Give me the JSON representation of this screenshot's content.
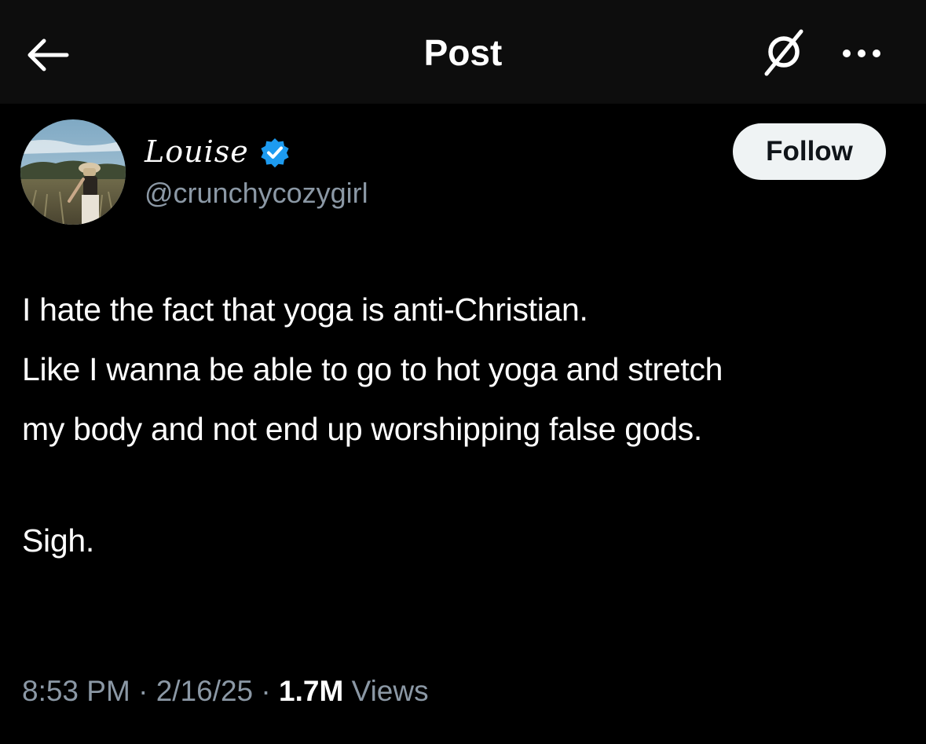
{
  "header": {
    "title": "Post",
    "back_icon": "arrow-left-icon",
    "grok_icon": "grok-icon",
    "more_icon": "more-horizontal-icon"
  },
  "author": {
    "display_name": "Louise",
    "handle": "@crunchycozygirl",
    "verified_icon": "verified-badge-icon",
    "verified_color": "#1d9bf0"
  },
  "follow_label": "Follow",
  "post": {
    "line_1": "I hate the fact that yoga is anti-Christian.",
    "line_2": "Like I wanna be able to go to hot yoga and stretch",
    "line_3": "my body and not end up worshipping false gods.",
    "line_4": "Sigh."
  },
  "meta": {
    "time": "8:53 PM",
    "separator": " · ",
    "date": "2/16/25",
    "views_count": "1.7M",
    "views_label": "Views"
  }
}
